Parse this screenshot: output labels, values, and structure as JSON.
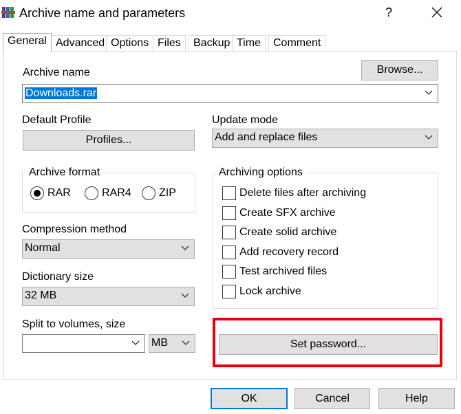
{
  "window": {
    "title": "Archive name and parameters",
    "help_label": "?"
  },
  "tabs": [
    "General",
    "Advanced",
    "Options",
    "Files",
    "Backup",
    "Time",
    "Comment"
  ],
  "general": {
    "archive_name_label": "Archive name",
    "browse_label": "Browse...",
    "archive_name_value": "Downloads.rar",
    "default_profile_label": "Default Profile",
    "profiles_label": "Profiles...",
    "update_mode_label": "Update mode",
    "update_mode_value": "Add and replace files",
    "archive_format_label": "Archive format",
    "formats": [
      "RAR",
      "RAR4",
      "ZIP"
    ],
    "selected_format": "RAR",
    "compression_method_label": "Compression method",
    "compression_method_value": "Normal",
    "dictionary_size_label": "Dictionary size",
    "dictionary_size_value": "32 MB",
    "split_label": "Split to volumes, size",
    "split_value": "",
    "split_unit_value": "MB",
    "archiving_options_label": "Archiving options",
    "options": [
      "Delete files after archiving",
      "Create SFX archive",
      "Create solid archive",
      "Add recovery record",
      "Test archived files",
      "Lock archive"
    ],
    "set_password_label": "Set password..."
  },
  "footer": {
    "ok_label": "OK",
    "cancel_label": "Cancel",
    "help_label": "Help"
  },
  "colors": {
    "selection": "#0078d7",
    "highlight_box": "#e8000b",
    "button_face": "#e1e1e1"
  }
}
